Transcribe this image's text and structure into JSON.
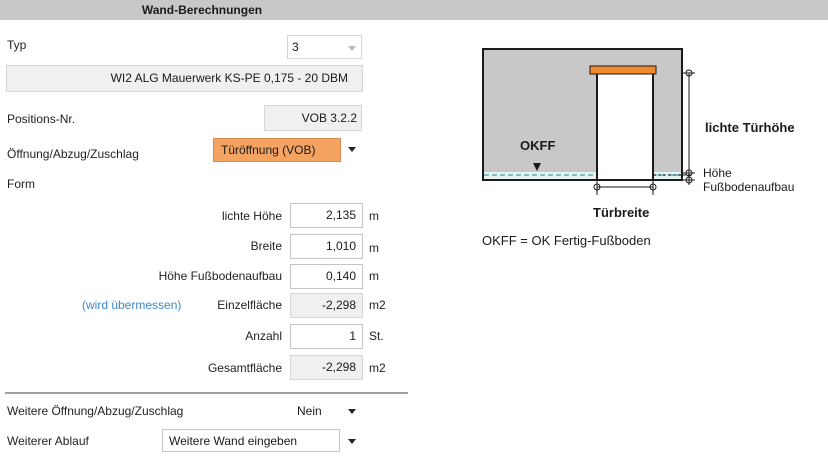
{
  "header": {
    "title": "Wand-Berechnungen"
  },
  "form": {
    "typ_label": "Typ",
    "typ_value": "3",
    "description": "WI2 ALG Mauerwerk KS-PE 0,175 - 20  DBM",
    "positions_label": "Positions-Nr.",
    "positions_value": "VOB 3.2.2",
    "oeffnung_label": "Öffnung/Abzug/Zuschlag",
    "oeffnung_value": "Türöffnung (VOB)",
    "oeffnung_color": "#f4a361",
    "form_label": "Form",
    "lichte_hoehe_label": "lichte Höhe",
    "lichte_hoehe_value": "2,135",
    "lichte_hoehe_unit": "m",
    "breite_label": "Breite",
    "breite_value": "1,010",
    "breite_unit": "m",
    "fussboden_label": "Höhe Fußbodenaufbau",
    "fussboden_value": "0,140",
    "fussboden_unit": "m",
    "uebermessen_note": "(wird übermessen)",
    "einzelflaeche_label": "Einzelfläche",
    "einzelflaeche_value": "-2,298",
    "einzelflaeche_unit": "m2",
    "anzahl_label": "Anzahl",
    "anzahl_value": "1",
    "anzahl_unit": "St.",
    "gesamtflaeche_label": "Gesamtfläche",
    "gesamtflaeche_value": "-2,298",
    "gesamtflaeche_unit": "m2",
    "weitere_oeffnung_label": "Weitere Öffnung/Abzug/Zuschlag",
    "weitere_oeffnung_value": "Nein",
    "weiterer_ablauf_label": "Weiterer Ablauf",
    "weiterer_ablauf_value": "Weitere Wand eingeben"
  },
  "diagram": {
    "okff_label": "OKFF",
    "lichte_tuerhoehe_label": "lichte Türhöhe",
    "hoehe_label": "Höhe",
    "fussbodenaufbau_label": "Fußbodenaufbau",
    "tuerbreite_label": "Türbreite",
    "legend": "OKFF = OK Fertig-Fußboden"
  },
  "colors": {
    "header_bg": "#c8c8c8",
    "wall_fill": "#c8c8c8",
    "lintel": "#f08a2c",
    "floor_line": "#58b4b4",
    "note_blue": "#3b86c8"
  }
}
